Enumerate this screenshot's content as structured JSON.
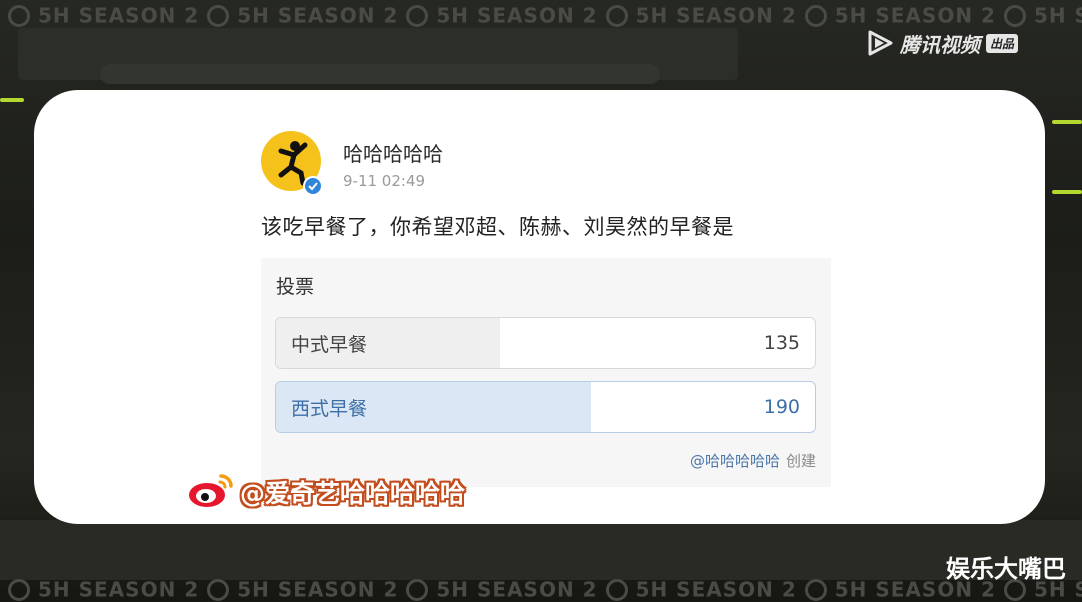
{
  "background": {
    "banner_text": "5H SEASON 2"
  },
  "logo": {
    "brand": "腾讯视频",
    "badge": "出品"
  },
  "post": {
    "username": "哈哈哈哈哈",
    "time": "9-11 02:49",
    "text": "该吃早餐了，你希望邓超、陈赫、刘昊然的早餐是",
    "poll": {
      "title": "投票",
      "options": [
        {
          "label": "中式早餐",
          "count": "135",
          "share": 0.415
        },
        {
          "label": "西式早餐",
          "count": "190",
          "share": 0.585
        }
      ],
      "creator": "@哈哈哈哈哈",
      "creator_action": "创建"
    }
  },
  "watermark": {
    "weibo_handle": "@爱奇艺哈哈哈哈哈"
  },
  "corner": {
    "text": "娱乐大嘴巴"
  },
  "colors": {
    "avatar": "#f5c21b",
    "verify": "#2f86d9",
    "poll_highlight": "#dbe7f4",
    "weibo_red": "#e6162d"
  }
}
